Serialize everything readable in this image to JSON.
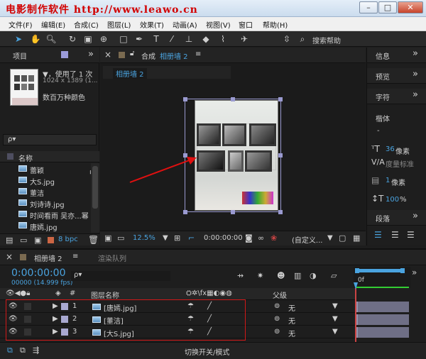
{
  "watermark": "电影制作软件 http://www.leawo.cn",
  "window_buttons": [
    "–",
    "□",
    "✕"
  ],
  "menu": [
    "文件(F)",
    "编辑(E)",
    "合成(C)",
    "图层(L)",
    "效果(T)",
    "动画(A)",
    "视图(V)",
    "窗口",
    "帮助(H)"
  ],
  "toolbar": {
    "search_label": "搜索帮助"
  },
  "project": {
    "tab": "项目",
    "info_line1": "▼，使用了 1 次",
    "info_line2": "1024 x 1389 (1...",
    "info_line3": "数百万种颜色",
    "search_placeholder": "ρ▾",
    "col_name": "名称",
    "bpc": "8 bpc",
    "items": [
      "蕾颖",
      "大S.jpg",
      "董洁",
      "刘诗诗.jpg",
      "时间看雨 吴亦...幂",
      "唐嫣.jpg"
    ]
  },
  "comp": {
    "tab_prefix": "合成",
    "tab_name": "相册墙 2",
    "sub_tab": "相册墙 2",
    "zoom": "12.5%",
    "timecode": "0:00:00:00",
    "view_mode": "(自定义..."
  },
  "right": {
    "info": "信息",
    "preview": "预览",
    "chars": "字符",
    "font": "楷体",
    "font_style": "-",
    "size_val": "36",
    "size_unit": "像素",
    "tracking_label": "度量标准",
    "stroke_val": "1",
    "stroke_unit": "像素",
    "scale": "100",
    "scale_unit": "%",
    "para": "段落"
  },
  "timeline": {
    "tab": "相册墙 2",
    "render_tab": "渲染队列",
    "timecode": "0:00:00:00",
    "fps": "00000 (14.999 fps)",
    "search_placeholder": "ρ▾",
    "col_num": "#",
    "col_name": "图层名称",
    "col_parent": "父级",
    "footer": "切换开关/模式",
    "ruler_start": "0f",
    "ruler_end": "",
    "layers": [
      {
        "num": "1",
        "name": "[唐嫣.jpg]",
        "parent": "无"
      },
      {
        "num": "2",
        "name": "[董洁]",
        "parent": "无"
      },
      {
        "num": "3",
        "name": "[大S.jpg]",
        "parent": "无"
      }
    ]
  }
}
